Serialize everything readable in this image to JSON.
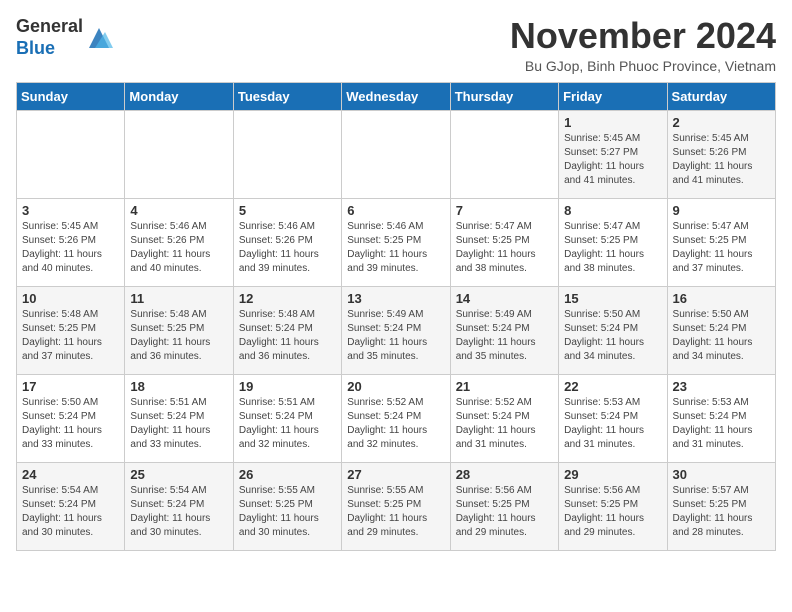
{
  "header": {
    "logo_line1": "General",
    "logo_line2": "Blue",
    "month_title": "November 2024",
    "location": "Bu GJop, Binh Phuoc Province, Vietnam"
  },
  "weekdays": [
    "Sunday",
    "Monday",
    "Tuesday",
    "Wednesday",
    "Thursday",
    "Friday",
    "Saturday"
  ],
  "weeks": [
    [
      {
        "day": "",
        "info": ""
      },
      {
        "day": "",
        "info": ""
      },
      {
        "day": "",
        "info": ""
      },
      {
        "day": "",
        "info": ""
      },
      {
        "day": "",
        "info": ""
      },
      {
        "day": "1",
        "info": "Sunrise: 5:45 AM\nSunset: 5:27 PM\nDaylight: 11 hours and 41 minutes."
      },
      {
        "day": "2",
        "info": "Sunrise: 5:45 AM\nSunset: 5:26 PM\nDaylight: 11 hours and 41 minutes."
      }
    ],
    [
      {
        "day": "3",
        "info": "Sunrise: 5:45 AM\nSunset: 5:26 PM\nDaylight: 11 hours and 40 minutes."
      },
      {
        "day": "4",
        "info": "Sunrise: 5:46 AM\nSunset: 5:26 PM\nDaylight: 11 hours and 40 minutes."
      },
      {
        "day": "5",
        "info": "Sunrise: 5:46 AM\nSunset: 5:26 PM\nDaylight: 11 hours and 39 minutes."
      },
      {
        "day": "6",
        "info": "Sunrise: 5:46 AM\nSunset: 5:25 PM\nDaylight: 11 hours and 39 minutes."
      },
      {
        "day": "7",
        "info": "Sunrise: 5:47 AM\nSunset: 5:25 PM\nDaylight: 11 hours and 38 minutes."
      },
      {
        "day": "8",
        "info": "Sunrise: 5:47 AM\nSunset: 5:25 PM\nDaylight: 11 hours and 38 minutes."
      },
      {
        "day": "9",
        "info": "Sunrise: 5:47 AM\nSunset: 5:25 PM\nDaylight: 11 hours and 37 minutes."
      }
    ],
    [
      {
        "day": "10",
        "info": "Sunrise: 5:48 AM\nSunset: 5:25 PM\nDaylight: 11 hours and 37 minutes."
      },
      {
        "day": "11",
        "info": "Sunrise: 5:48 AM\nSunset: 5:25 PM\nDaylight: 11 hours and 36 minutes."
      },
      {
        "day": "12",
        "info": "Sunrise: 5:48 AM\nSunset: 5:24 PM\nDaylight: 11 hours and 36 minutes."
      },
      {
        "day": "13",
        "info": "Sunrise: 5:49 AM\nSunset: 5:24 PM\nDaylight: 11 hours and 35 minutes."
      },
      {
        "day": "14",
        "info": "Sunrise: 5:49 AM\nSunset: 5:24 PM\nDaylight: 11 hours and 35 minutes."
      },
      {
        "day": "15",
        "info": "Sunrise: 5:50 AM\nSunset: 5:24 PM\nDaylight: 11 hours and 34 minutes."
      },
      {
        "day": "16",
        "info": "Sunrise: 5:50 AM\nSunset: 5:24 PM\nDaylight: 11 hours and 34 minutes."
      }
    ],
    [
      {
        "day": "17",
        "info": "Sunrise: 5:50 AM\nSunset: 5:24 PM\nDaylight: 11 hours and 33 minutes."
      },
      {
        "day": "18",
        "info": "Sunrise: 5:51 AM\nSunset: 5:24 PM\nDaylight: 11 hours and 33 minutes."
      },
      {
        "day": "19",
        "info": "Sunrise: 5:51 AM\nSunset: 5:24 PM\nDaylight: 11 hours and 32 minutes."
      },
      {
        "day": "20",
        "info": "Sunrise: 5:52 AM\nSunset: 5:24 PM\nDaylight: 11 hours and 32 minutes."
      },
      {
        "day": "21",
        "info": "Sunrise: 5:52 AM\nSunset: 5:24 PM\nDaylight: 11 hours and 31 minutes."
      },
      {
        "day": "22",
        "info": "Sunrise: 5:53 AM\nSunset: 5:24 PM\nDaylight: 11 hours and 31 minutes."
      },
      {
        "day": "23",
        "info": "Sunrise: 5:53 AM\nSunset: 5:24 PM\nDaylight: 11 hours and 31 minutes."
      }
    ],
    [
      {
        "day": "24",
        "info": "Sunrise: 5:54 AM\nSunset: 5:24 PM\nDaylight: 11 hours and 30 minutes."
      },
      {
        "day": "25",
        "info": "Sunrise: 5:54 AM\nSunset: 5:24 PM\nDaylight: 11 hours and 30 minutes."
      },
      {
        "day": "26",
        "info": "Sunrise: 5:55 AM\nSunset: 5:25 PM\nDaylight: 11 hours and 30 minutes."
      },
      {
        "day": "27",
        "info": "Sunrise: 5:55 AM\nSunset: 5:25 PM\nDaylight: 11 hours and 29 minutes."
      },
      {
        "day": "28",
        "info": "Sunrise: 5:56 AM\nSunset: 5:25 PM\nDaylight: 11 hours and 29 minutes."
      },
      {
        "day": "29",
        "info": "Sunrise: 5:56 AM\nSunset: 5:25 PM\nDaylight: 11 hours and 29 minutes."
      },
      {
        "day": "30",
        "info": "Sunrise: 5:57 AM\nSunset: 5:25 PM\nDaylight: 11 hours and 28 minutes."
      }
    ]
  ]
}
